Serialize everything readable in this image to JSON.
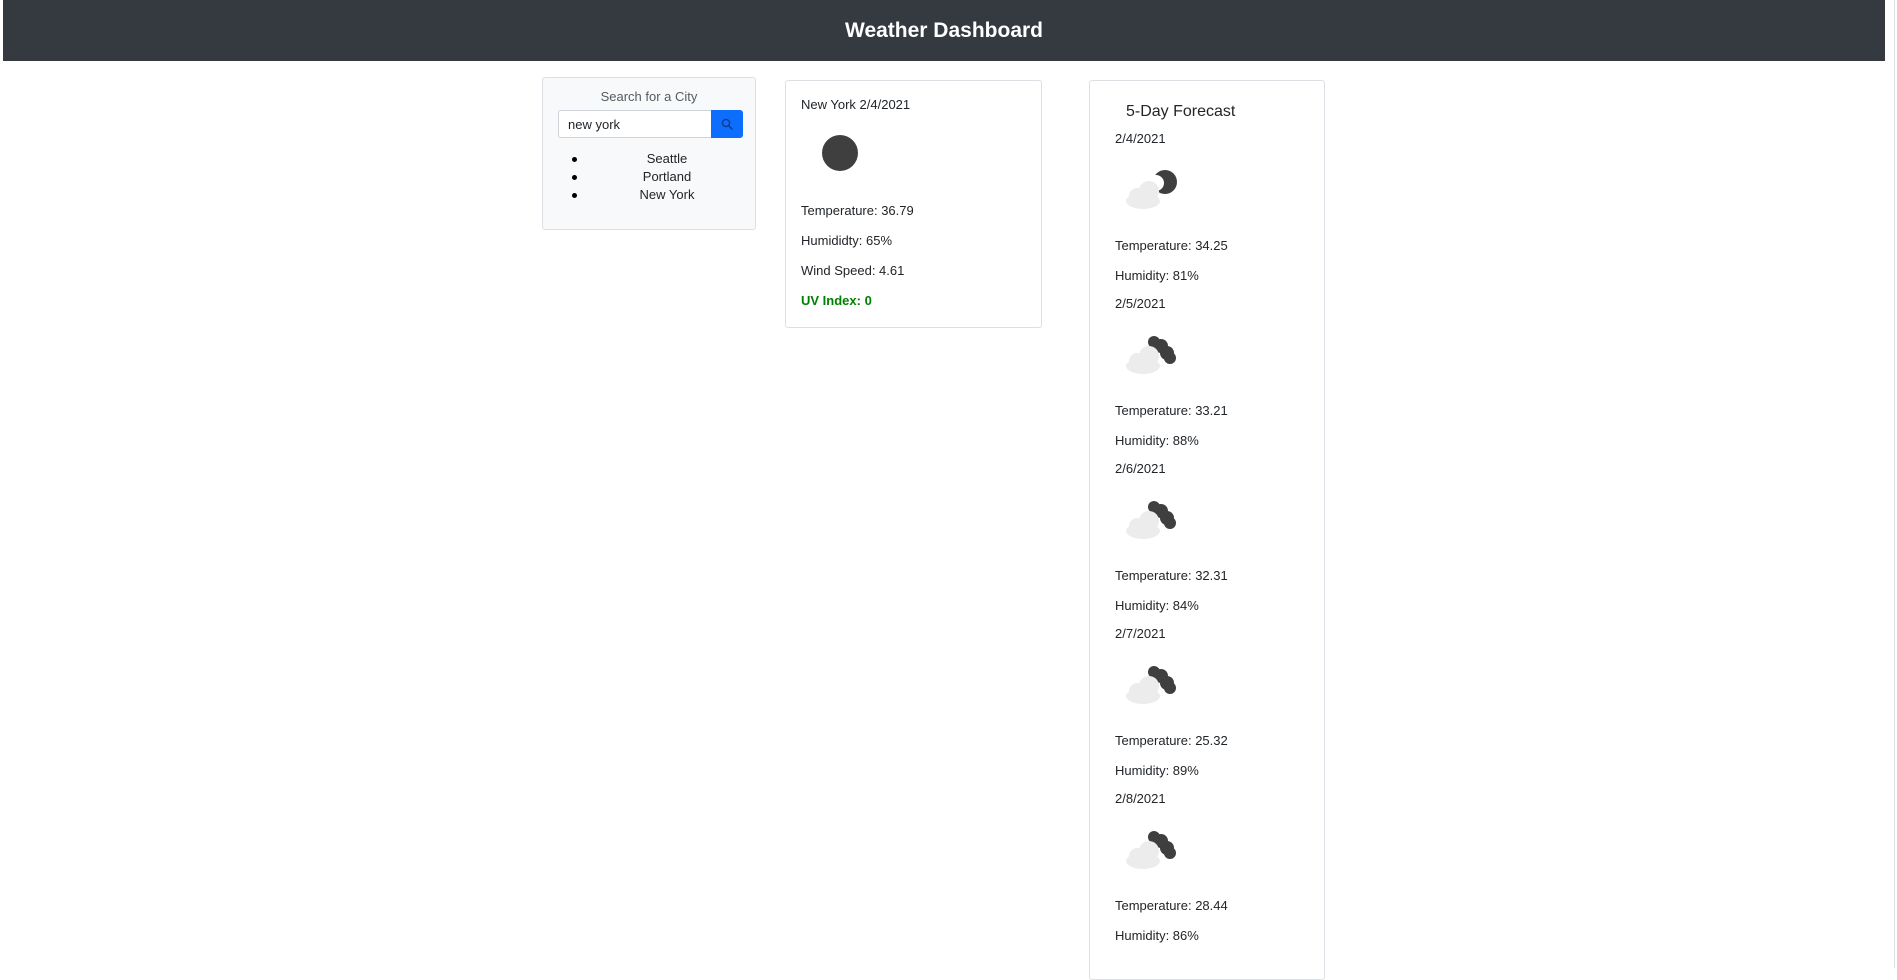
{
  "header": {
    "title": "Weather Dashboard"
  },
  "search": {
    "title": "Search for a City",
    "value": "new york",
    "icon": "search-icon",
    "history": [
      "Seattle",
      "Portland",
      "New York"
    ]
  },
  "current": {
    "title": "New York 2/4/2021",
    "icon": "moon-icon",
    "temperature": "Temperature: 36.79",
    "humidity": "Humididty: 65%",
    "wind": "Wind Speed: 4.61",
    "uv": "UV Index: 0",
    "uv_color": "#008000"
  },
  "forecast": {
    "title": "5-Day Forecast",
    "days": [
      {
        "date": "2/4/2021",
        "icon": "partly-cloudy-night-icon",
        "temperature": "Temperature: 34.25",
        "humidity": "Humidity: 81%"
      },
      {
        "date": "2/5/2021",
        "icon": "broken-clouds-icon",
        "temperature": "Temperature: 33.21",
        "humidity": "Humidity: 88%"
      },
      {
        "date": "2/6/2021",
        "icon": "broken-clouds-icon",
        "temperature": "Temperature: 32.31",
        "humidity": "Humidity: 84%"
      },
      {
        "date": "2/7/2021",
        "icon": "broken-clouds-icon",
        "temperature": "Temperature: 25.32",
        "humidity": "Humidity: 89%"
      },
      {
        "date": "2/8/2021",
        "icon": "broken-clouds-icon",
        "temperature": "Temperature: 28.44",
        "humidity": "Humidity: 86%"
      }
    ]
  },
  "colors": {
    "header_bg": "#343a40",
    "accent": "#0d6efd",
    "icon_dark": "#3f3f3f",
    "cloud_light": "#ececec"
  }
}
